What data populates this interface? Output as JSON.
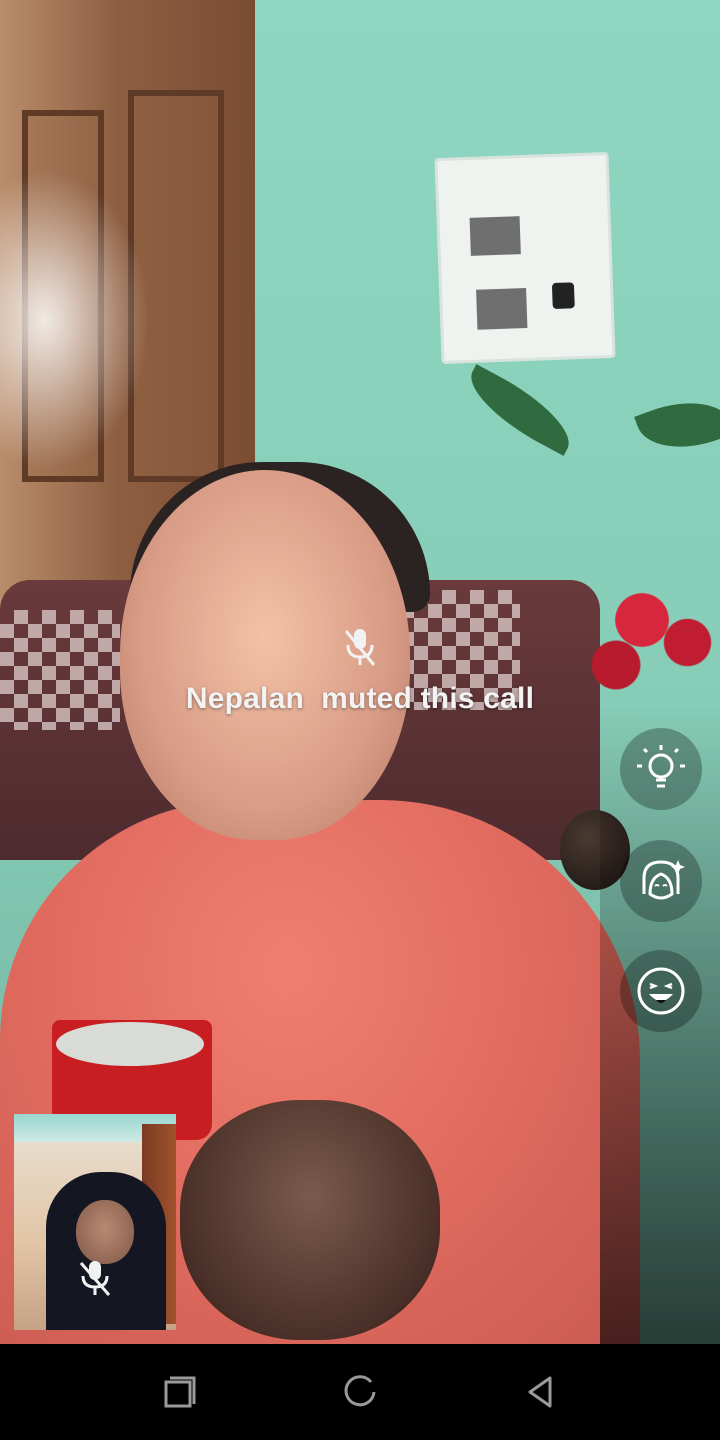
{
  "call": {
    "muted_message": "Nepalan  muted this call"
  },
  "effects": [
    {
      "icon": "lightbulb-icon"
    },
    {
      "icon": "face-beauty-icon"
    },
    {
      "icon": "emoji-face-icon"
    }
  ],
  "self_view": {
    "mic_status_icon": "mic-off-icon"
  },
  "nav": {
    "recents_icon": "recents-square-icon",
    "home_icon": "home-circle-icon",
    "back_icon": "back-triangle-icon"
  }
}
